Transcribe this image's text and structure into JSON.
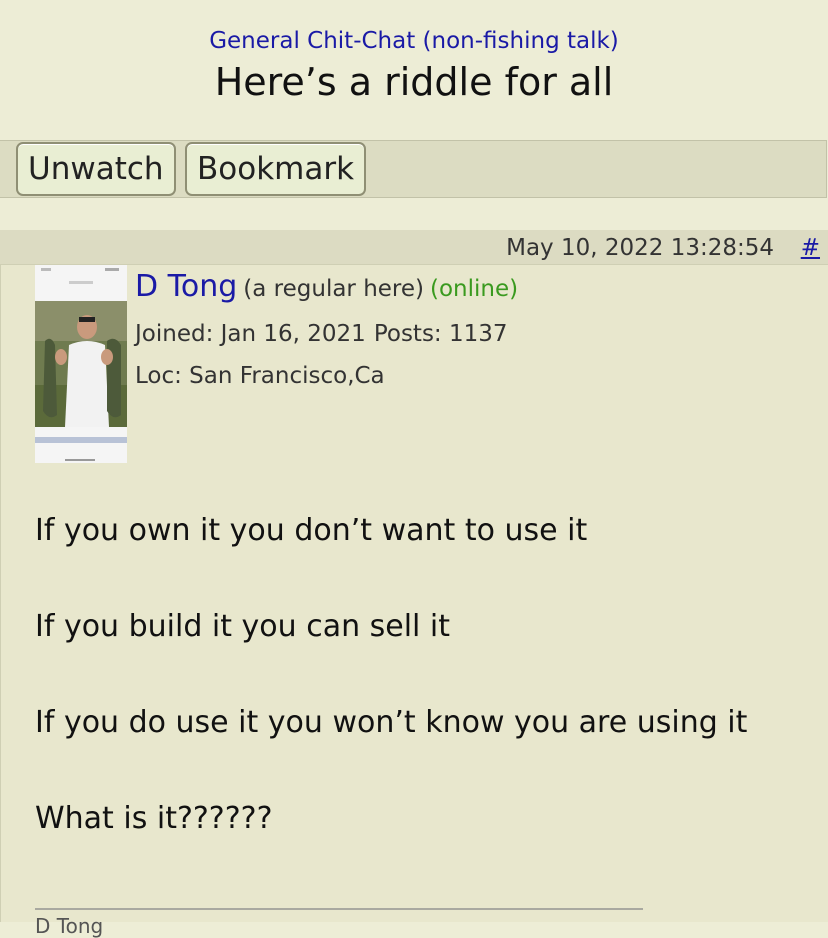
{
  "header": {
    "forum_link": "General Chit-Chat (non-fishing talk)",
    "thread_title": "Here’s a riddle for all"
  },
  "toolbar": {
    "unwatch_label": "Unwatch",
    "bookmark_label": "Bookmark"
  },
  "post": {
    "date": "May 10, 2022 13:28:54",
    "anchor": "#",
    "author": {
      "name": "D Tong",
      "role": "(a regular here)",
      "status": "(online)",
      "joined": "Joined: Jan 16, 2021",
      "posts": "Posts: 1137",
      "location": "Loc: San Francisco,Ca"
    },
    "message": [
      "If you own it you don’t want to use it",
      "If you build it you can sell it",
      "If you do use it you won’t know you are using it",
      "What is it??????"
    ],
    "signature": "D Tong"
  },
  "colors": {
    "page_background": "#ededd6",
    "link": "#1a1aa6",
    "online": "#3a9a1f"
  }
}
